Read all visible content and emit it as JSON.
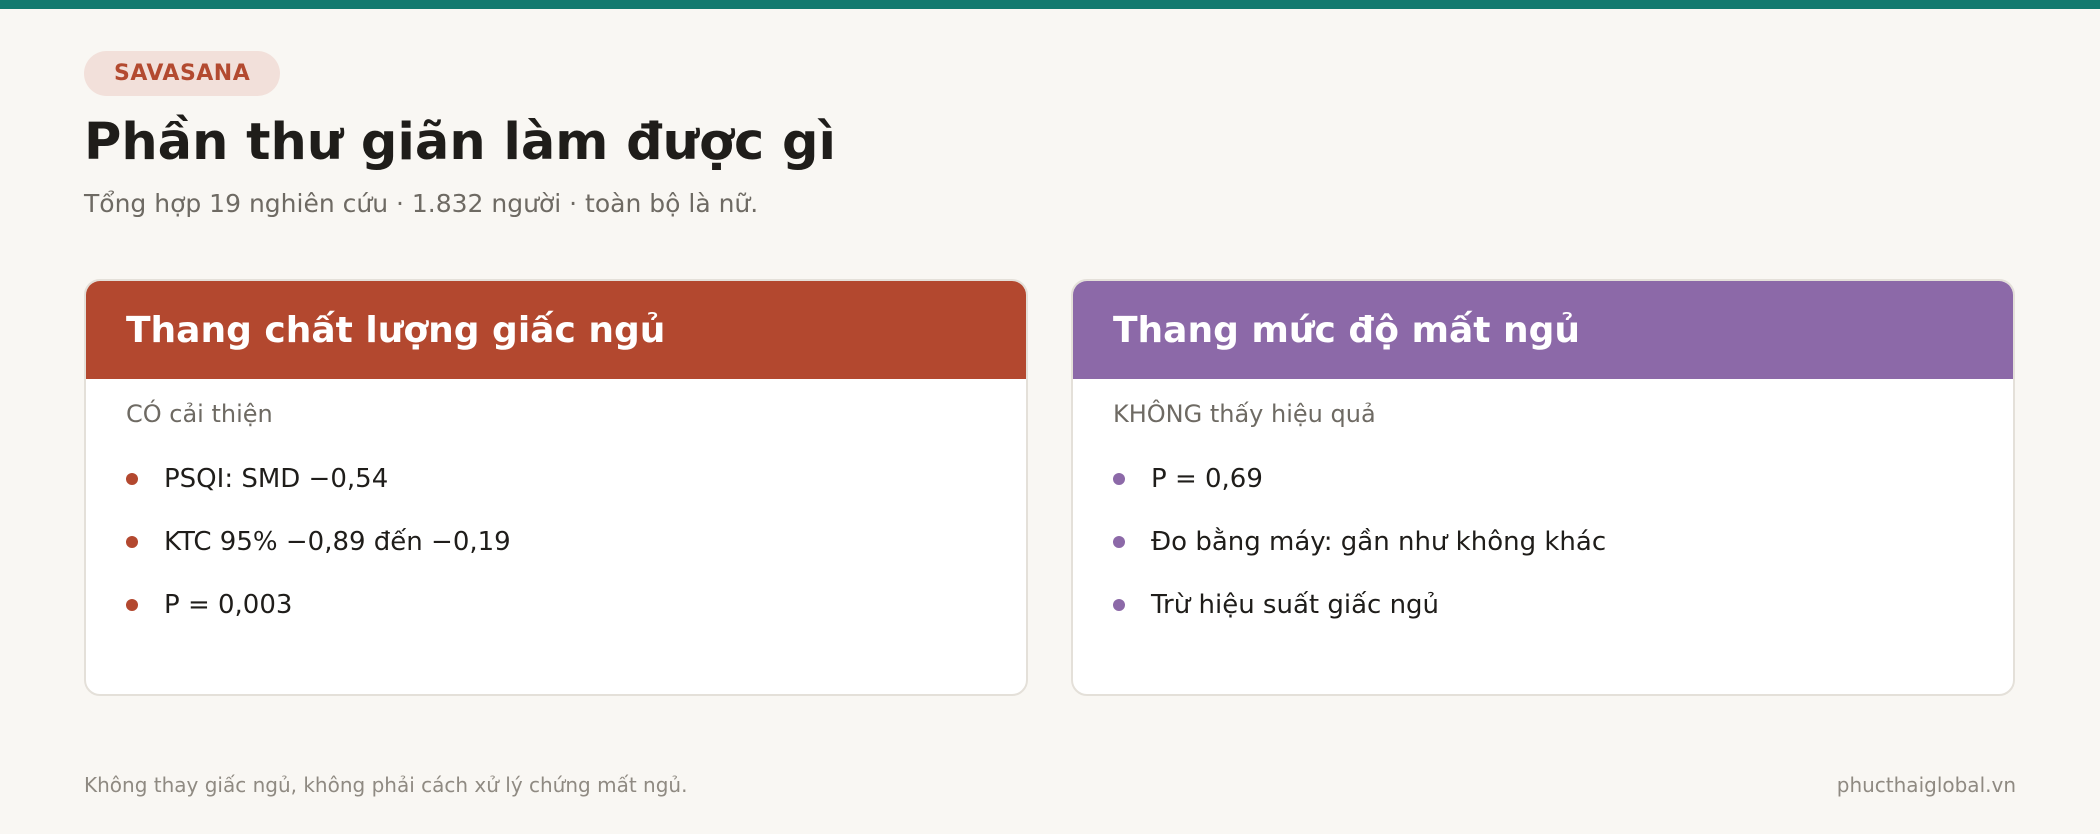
{
  "tag": "SAVASANA",
  "title": "Phần thư giãn làm được gì",
  "subtitle": "Tổng hợp 19 nghiên cứu · 1.832 người · toàn bộ là nữ.",
  "cards": [
    {
      "title": "Thang chất lượng giấc ngủ",
      "note": "CÓ cải thiện",
      "color": "#b3482f",
      "items": [
        "PSQI: SMD −0,54",
        "KTC 95% −0,89 đến −0,19",
        "P = 0,003"
      ]
    },
    {
      "title": "Thang mức độ mất ngủ",
      "note": "KHÔNG thấy hiệu quả",
      "color": "#8c69a8",
      "items": [
        "P = 0,69",
        "Đo bằng máy: gần như không khác",
        "Trừ hiệu suất giấc ngủ"
      ]
    }
  ],
  "footer": {
    "note": "Không thay giấc ngủ, không phải cách xử lý chứng mất ngủ.",
    "site": "phucthaiglobal.vn"
  },
  "colors": {
    "top_bar": "#137a6f",
    "background": "#f9f7f3"
  }
}
